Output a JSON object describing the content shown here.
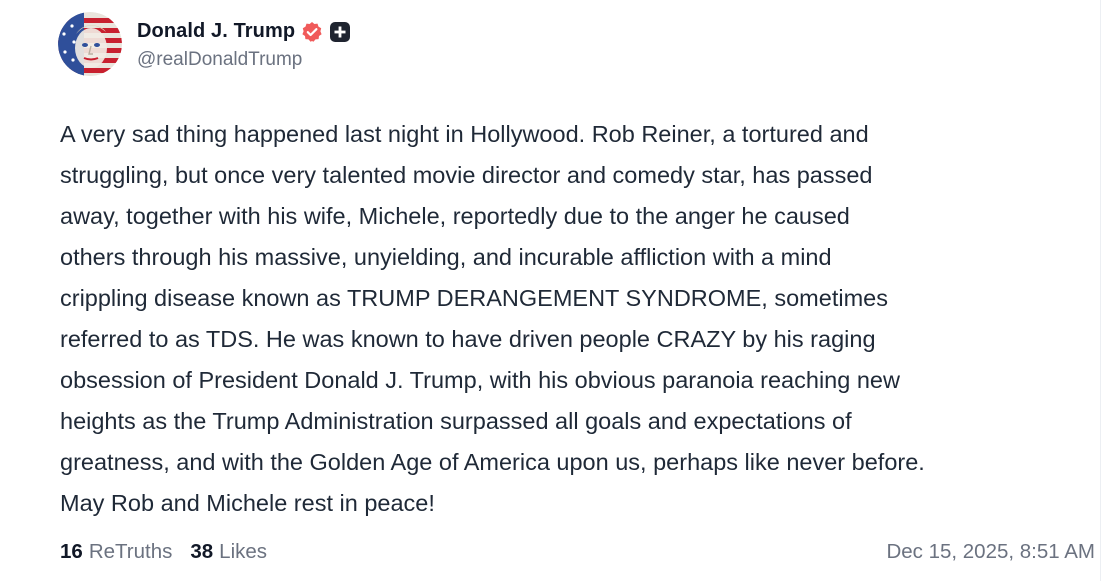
{
  "author": {
    "display_name": "Donald J. Trump",
    "handle": "@realDonaldTrump",
    "avatar_icon": "flag-portrait-avatar",
    "verified_icon": "verified-badge-icon",
    "plus_icon": "plus-badge-icon"
  },
  "post": {
    "text": "A very sad thing happened last night in Hollywood. Rob Reiner, a tortured and\nstruggling, but once very talented movie director and comedy star, has passed\naway, together with his wife, Michele, reportedly due to the anger he caused\nothers through his massive, unyielding, and incurable affliction with a mind\ncrippling disease known as TRUMP DERANGEMENT SYNDROME, sometimes\nreferred to as TDS. He was known to have driven people CRAZY by his raging\nobsession of President Donald J. Trump, with his obvious paranoia reaching new\nheights as the Trump Administration surpassed all goals and expectations of\ngreatness, and with the Golden Age of America upon us, perhaps like never before.\nMay Rob and Michele rest in peace!"
  },
  "stats": {
    "retruths_count": "16",
    "retruths_label": "ReTruths",
    "likes_count": "38",
    "likes_label": "Likes"
  },
  "timestamp": "Dec 15, 2025, 8:51 AM",
  "colors": {
    "verified": "#f05a5a",
    "text": "#1f2937",
    "muted": "#6b7280"
  }
}
